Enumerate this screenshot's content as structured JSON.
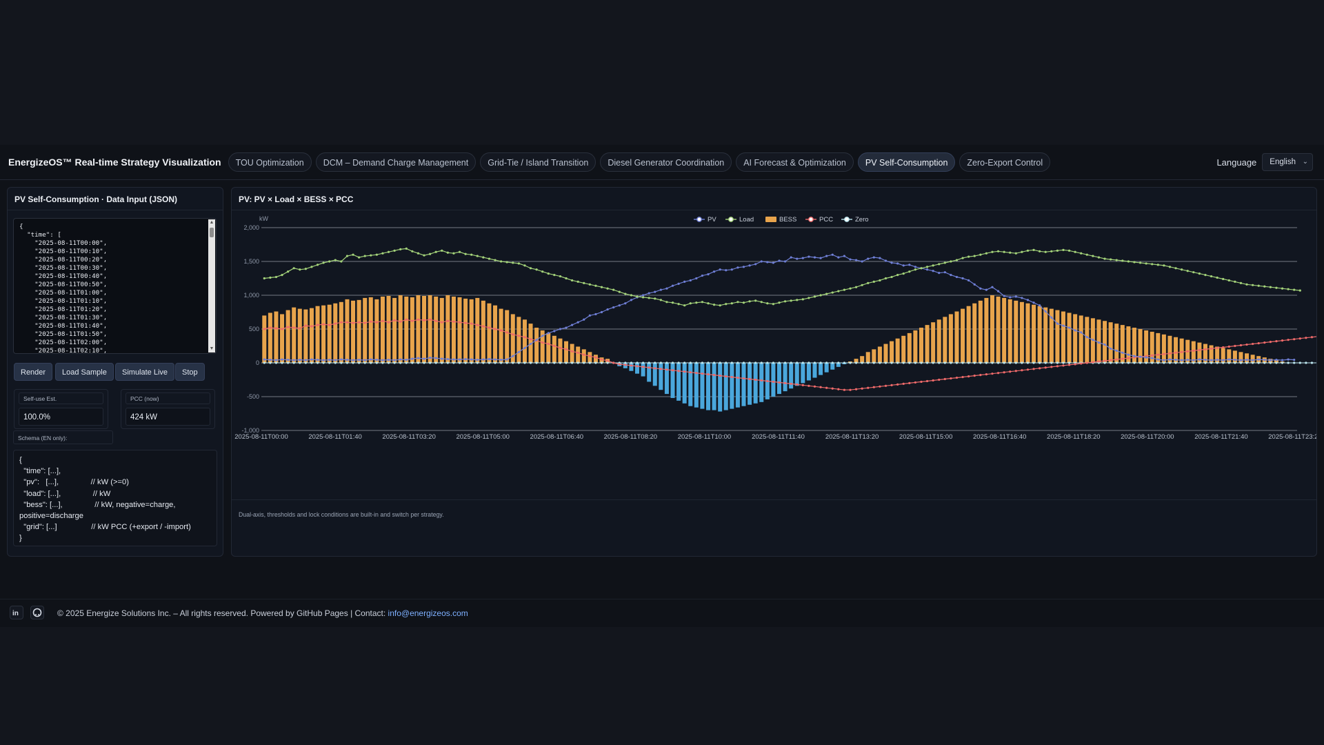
{
  "header": {
    "brand": "EnergizeOS™ Real-time Strategy Visualization",
    "tabs": [
      {
        "label": "TOU Optimization",
        "active": false
      },
      {
        "label": "DCM – Demand Charge Management",
        "active": false
      },
      {
        "label": "Grid-Tie / Island Transition",
        "active": false
      },
      {
        "label": "Diesel Generator Coordination",
        "active": false
      },
      {
        "label": "AI Forecast & Optimization",
        "active": false
      },
      {
        "label": "PV Self-Consumption",
        "active": true
      },
      {
        "label": "Zero-Export Control",
        "active": false
      }
    ],
    "language_label": "Language",
    "language_value": "English"
  },
  "input_panel": {
    "title": "PV Self-Consumption · Data Input (JSON)",
    "json_text": "{\n  \"time\": [\n    \"2025-08-11T00:00\",\n    \"2025-08-11T00:10\",\n    \"2025-08-11T00:20\",\n    \"2025-08-11T00:30\",\n    \"2025-08-11T00:40\",\n    \"2025-08-11T00:50\",\n    \"2025-08-11T01:00\",\n    \"2025-08-11T01:10\",\n    \"2025-08-11T01:20\",\n    \"2025-08-11T01:30\",\n    \"2025-08-11T01:40\",\n    \"2025-08-11T01:50\",\n    \"2025-08-11T02:00\",\n    \"2025-08-11T02:10\",",
    "buttons": {
      "render": "Render",
      "load_sample": "Load Sample",
      "simulate_live": "Simulate Live",
      "stop": "Stop"
    },
    "stats": {
      "self_use_label": "Self-use Est.",
      "self_use_value": "100.0%",
      "pcc_label": "PCC (now)",
      "pcc_value": "424 kW"
    },
    "schema_label": "Schema (EN only):",
    "schema_text": "{\n  \"time\": [...],\n  \"pv\":   [...],               // kW (>=0)\n  \"load\": [...],               // kW\n  \"bess\": [...],               // kW, negative=charge, positive=discharge\n  \"grid\": [...]                // kW PCC (+export / -import)\n}"
  },
  "chart_panel": {
    "title": "PV: PV × Load × BESS × PCC",
    "note": "Dual-axis, thresholds and lock conditions are built-in and switch per strategy."
  },
  "colors": {
    "pv": "#6f7fd6",
    "load": "#a4d37a",
    "bess_pos": "#e8a44c",
    "bess_neg": "#4aa7dc",
    "pcc": "#ef6a6a",
    "zero": "#bde7ef"
  },
  "chart_data": {
    "type": "line",
    "title": "PV: PV × Load × BESS × PCC",
    "ylabel": "kW",
    "ylim": [
      -1000,
      2000
    ],
    "yticks": [
      -1000,
      -500,
      0,
      500,
      1000,
      1500,
      2000
    ],
    "ytick_labels": [
      "-1,000",
      "-500",
      "0",
      "500",
      "1,000",
      "1,500",
      "2,000"
    ],
    "xtick_labels": [
      "2025-08-11T00:00",
      "2025-08-11T01:40",
      "2025-08-11T03:20",
      "2025-08-11T05:00",
      "2025-08-11T06:40",
      "2025-08-11T08:20",
      "2025-08-11T10:00",
      "2025-08-11T11:40",
      "2025-08-11T13:20",
      "2025-08-11T15:00",
      "2025-08-11T16:40",
      "2025-08-11T18:20",
      "2025-08-11T20:00",
      "2025-08-11T21:40",
      "2025-08-11T23:20"
    ],
    "legend": [
      "PV",
      "Load",
      "BESS",
      "PCC",
      "Zero"
    ],
    "legend_position": "top-center",
    "grid": true,
    "x_start": "2025-08-11T00:00",
    "x_step_minutes": 10,
    "series": [
      {
        "name": "PV",
        "kind": "line",
        "values": [
          50,
          45,
          40,
          50,
          45,
          40,
          45,
          40,
          50,
          45,
          40,
          45,
          40,
          50,
          45,
          40,
          45,
          40,
          50,
          45,
          40,
          45,
          40,
          50,
          45,
          60,
          70,
          60,
          75,
          70,
          60,
          55,
          50,
          50,
          55,
          50,
          45,
          50,
          55,
          50,
          45,
          50,
          100,
          160,
          220,
          280,
          340,
          400,
          440,
          470,
          500,
          520,
          560,
          600,
          640,
          700,
          720,
          750,
          790,
          820,
          850,
          880,
          930,
          970,
          1000,
          1030,
          1050,
          1080,
          1100,
          1140,
          1170,
          1200,
          1220,
          1250,
          1290,
          1310,
          1350,
          1380,
          1370,
          1380,
          1410,
          1420,
          1440,
          1460,
          1500,
          1490,
          1480,
          1510,
          1500,
          1560,
          1540,
          1550,
          1570,
          1560,
          1550,
          1580,
          1600,
          1560,
          1580,
          1530,
          1520,
          1500,
          1540,
          1560,
          1550,
          1510,
          1480,
          1470,
          1440,
          1450,
          1420,
          1400,
          1380,
          1360,
          1330,
          1340,
          1300,
          1270,
          1250,
          1220,
          1160,
          1100,
          1080,
          1120,
          1060,
          990,
          970,
          980,
          960,
          930,
          890,
          850,
          760,
          670,
          580,
          550,
          520,
          480,
          450,
          380,
          340,
          300,
          270,
          210,
          180,
          150,
          120,
          100,
          90,
          80,
          70,
          50,
          40,
          50,
          45,
          40,
          45,
          40,
          50,
          45,
          40,
          45,
          40,
          50,
          45,
          40,
          45,
          40,
          50,
          45,
          40,
          45,
          40,
          50,
          45
        ]
      },
      {
        "name": "Load",
        "kind": "line",
        "values": [
          1250,
          1260,
          1270,
          1300,
          1350,
          1400,
          1380,
          1390,
          1420,
          1450,
          1480,
          1500,
          1520,
          1500,
          1580,
          1600,
          1560,
          1580,
          1590,
          1600,
          1620,
          1640,
          1660,
          1680,
          1690,
          1650,
          1620,
          1590,
          1610,
          1640,
          1660,
          1630,
          1620,
          1640,
          1610,
          1600,
          1580,
          1560,
          1540,
          1520,
          1500,
          1490,
          1480,
          1470,
          1440,
          1400,
          1380,
          1350,
          1320,
          1300,
          1280,
          1250,
          1220,
          1200,
          1180,
          1160,
          1140,
          1120,
          1100,
          1080,
          1050,
          1020,
          1000,
          980,
          970,
          960,
          950,
          930,
          900,
          890,
          870,
          850,
          880,
          890,
          900,
          880,
          860,
          850,
          870,
          880,
          900,
          890,
          910,
          920,
          900,
          880,
          870,
          890,
          910,
          920,
          930,
          940,
          960,
          980,
          1000,
          1020,
          1040,
          1060,
          1080,
          1100,
          1120,
          1150,
          1180,
          1200,
          1220,
          1250,
          1270,
          1300,
          1320,
          1350,
          1380,
          1400,
          1420,
          1440,
          1460,
          1480,
          1500,
          1520,
          1550,
          1570,
          1580,
          1600,
          1620,
          1640,
          1650,
          1640,
          1630,
          1620,
          1640,
          1660,
          1670,
          1650,
          1640,
          1650,
          1660,
          1670,
          1660,
          1640,
          1620,
          1600,
          1580,
          1560,
          1540,
          1530,
          1520,
          1510,
          1500,
          1490,
          1480,
          1470,
          1460,
          1450,
          1440,
          1420,
          1400,
          1380,
          1360,
          1340,
          1320,
          1300,
          1280,
          1260,
          1240,
          1220,
          1200,
          1180,
          1160,
          1150,
          1140,
          1130,
          1120,
          1110,
          1100,
          1090,
          1080,
          1070
        ]
      },
      {
        "name": "BESS",
        "kind": "bar",
        "values": [
          700,
          740,
          760,
          720,
          780,
          820,
          800,
          790,
          810,
          840,
          850,
          860,
          880,
          900,
          940,
          920,
          930,
          960,
          970,
          940,
          980,
          990,
          960,
          1000,
          980,
          970,
          1000,
          990,
          1000,
          980,
          960,
          1000,
          980,
          970,
          950,
          940,
          960,
          920,
          880,
          850,
          800,
          780,
          720,
          680,
          640,
          580,
          520,
          480,
          440,
          400,
          360,
          320,
          280,
          240,
          200,
          160,
          120,
          80,
          60,
          0,
          -50,
          -80,
          -120,
          -160,
          -200,
          -280,
          -340,
          -400,
          -460,
          -520,
          -560,
          -600,
          -640,
          -660,
          -680,
          -700,
          -700,
          -720,
          -700,
          -680,
          -660,
          -640,
          -620,
          -600,
          -580,
          -540,
          -500,
          -460,
          -420,
          -380,
          -340,
          -300,
          -260,
          -220,
          -180,
          -140,
          -100,
          -60,
          -20,
          20,
          60,
          100,
          160,
          200,
          240,
          280,
          320,
          360,
          400,
          440,
          480,
          520,
          560,
          600,
          640,
          680,
          720,
          760,
          800,
          840,
          880,
          920,
          960,
          1000,
          980,
          960,
          940,
          920,
          900,
          880,
          860,
          840,
          820,
          800,
          780,
          760,
          740,
          720,
          700,
          680,
          660,
          640,
          620,
          600,
          580,
          560,
          540,
          520,
          500,
          480,
          460,
          440,
          420,
          400,
          380,
          360,
          340,
          320,
          300,
          280,
          260,
          240,
          220,
          200,
          180,
          160,
          140,
          120,
          100,
          80,
          60,
          40,
          20
        ]
      },
      {
        "name": "PCC",
        "kind": "line",
        "values": [
          500,
          520,
          510,
          500,
          530,
          520,
          510,
          550,
          540,
          560,
          570,
          560,
          580,
          600,
          600,
          590,
          600,
          590,
          610,
          600,
          620,
          600,
          630,
          610,
          640,
          620,
          640,
          630,
          640,
          620,
          600,
          620,
          610,
          600,
          590,
          580,
          560,
          540,
          520,
          500,
          480,
          450,
          420,
          400,
          380,
          350,
          330,
          300,
          280,
          250,
          220,
          200,
          170,
          150,
          120,
          100,
          80,
          50,
          30,
          0,
          -20,
          -30,
          -40,
          -50,
          -60,
          -70,
          -80,
          -90,
          -100,
          -110,
          -120,
          -130,
          -140,
          -150,
          -160,
          -170,
          -180,
          -190,
          -200,
          -210,
          -220,
          -230,
          -240,
          -250,
          -260,
          -270,
          -280,
          -290,
          -300,
          -310,
          -320,
          -330,
          -340,
          -350,
          -360,
          -370,
          -380,
          -390,
          -400,
          -400,
          -390,
          -380,
          -370,
          -360,
          -350,
          -340,
          -330,
          -320,
          -310,
          -300,
          -290,
          -280,
          -270,
          -260,
          -250,
          -240,
          -230,
          -220,
          -210,
          -200,
          -190,
          -180,
          -170,
          -160,
          -150,
          -140,
          -130,
          -120,
          -110,
          -100,
          -90,
          -80,
          -70,
          -60,
          -50,
          -40,
          -30,
          -20,
          -10,
          0,
          10,
          20,
          30,
          40,
          50,
          60,
          70,
          80,
          90,
          100,
          110,
          120,
          130,
          140,
          150,
          160,
          170,
          180,
          190,
          200,
          210,
          220,
          230,
          240,
          250,
          260,
          270,
          280,
          290,
          300,
          310,
          320,
          330,
          340,
          350,
          360,
          370,
          380,
          390,
          400,
          410,
          420,
          424
        ]
      },
      {
        "name": "Zero",
        "kind": "line",
        "values": [
          0,
          0,
          0,
          0,
          0,
          0,
          0,
          0,
          0,
          0,
          0,
          0,
          0,
          0,
          0,
          0,
          0,
          0,
          0,
          0,
          0,
          0,
          0,
          0,
          0,
          0,
          0,
          0,
          0,
          0,
          0,
          0,
          0,
          0,
          0,
          0,
          0,
          0,
          0,
          0,
          0,
          0,
          0,
          0,
          0,
          0,
          0,
          0,
          0,
          0,
          0,
          0,
          0,
          0,
          0,
          0,
          0,
          0,
          0,
          0,
          0,
          0,
          0,
          0,
          0,
          0,
          0,
          0,
          0,
          0,
          0,
          0,
          0,
          0,
          0,
          0,
          0,
          0,
          0,
          0,
          0,
          0,
          0,
          0,
          0,
          0,
          0,
          0,
          0,
          0,
          0,
          0,
          0,
          0,
          0,
          0,
          0,
          0,
          0,
          0,
          0,
          0,
          0,
          0,
          0,
          0,
          0,
          0,
          0,
          0,
          0,
          0,
          0,
          0,
          0,
          0,
          0,
          0,
          0,
          0,
          0,
          0,
          0,
          0,
          0,
          0,
          0,
          0,
          0,
          0,
          0,
          0,
          0,
          0,
          0,
          0,
          0,
          0,
          0,
          0,
          0,
          0,
          0,
          0,
          0,
          0,
          0,
          0,
          0,
          0,
          0,
          0,
          0,
          0,
          0,
          0,
          0,
          0,
          0,
          0,
          0,
          0,
          0,
          0,
          0,
          0,
          0,
          0,
          0,
          0,
          0,
          0,
          0,
          0,
          0,
          0,
          0,
          0,
          0,
          0,
          0,
          0,
          0,
          0,
          0
        ]
      }
    ]
  },
  "footer": {
    "copyright": "© 2025 Energize Solutions Inc. – All rights reserved. Powered by GitHub Pages | Contact: ",
    "email": "info@energizeos.com"
  }
}
